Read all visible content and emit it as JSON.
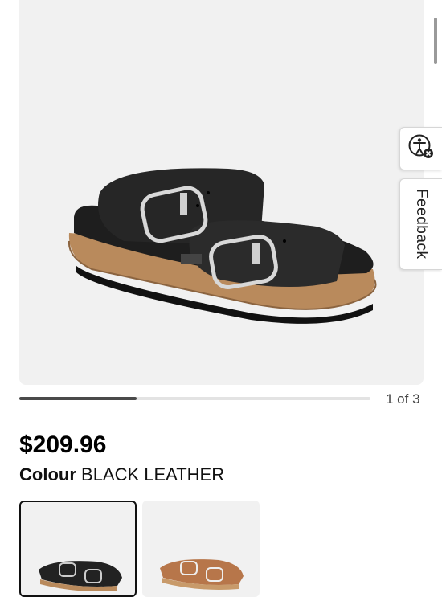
{
  "product": {
    "image_name": "black-leather-two-strap-sandal",
    "price": "$209.96",
    "colour_label": "Colour",
    "colour_value": "BLACK LEATHER"
  },
  "gallery": {
    "pager_text": "1 of 3",
    "progress_fraction": 0.333
  },
  "side_tabs": {
    "accessibility_icon": "accessibility-icon",
    "feedback_label": "Feedback"
  },
  "swatches": [
    {
      "name": "black-leather",
      "selected": true,
      "color": "#2a2a2a"
    },
    {
      "name": "tan-suede",
      "selected": false,
      "color": "#b7764a"
    }
  ],
  "colors": {
    "accent": "#111111",
    "image_bg": "#f1f1f1"
  }
}
